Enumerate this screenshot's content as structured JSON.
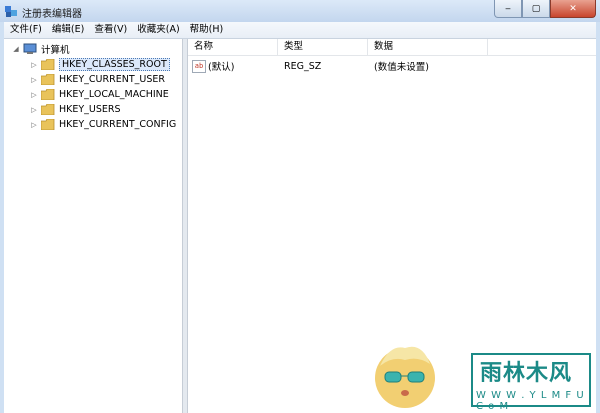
{
  "window": {
    "title": "注册表编辑器",
    "min_glyph": "‒",
    "max_glyph": "▢",
    "close_glyph": "✕"
  },
  "menu": [
    "文件(F)",
    "编辑(E)",
    "查看(V)",
    "收藏夹(A)",
    "帮助(H)"
  ],
  "tree": {
    "root": "计算机",
    "items": [
      {
        "label": "HKEY_CLASSES_ROOT",
        "selected": true
      },
      {
        "label": "HKEY_CURRENT_USER"
      },
      {
        "label": "HKEY_LOCAL_MACHINE"
      },
      {
        "label": "HKEY_USERS"
      },
      {
        "label": "HKEY_CURRENT_CONFIG"
      }
    ],
    "expand_glyph": "▷",
    "root_expand_glyph": "◢"
  },
  "list": {
    "columns": [
      "名称",
      "类型",
      "数据"
    ],
    "rows": [
      {
        "name": "(默认)",
        "type": "REG_SZ",
        "data": "(数值未设置)",
        "icon_text": "ab"
      }
    ]
  },
  "watermark": {
    "title": "雨林木风",
    "subtitle": "W W W . Y L M F U . C o M"
  },
  "colors": {
    "accent": "#1b8a87",
    "title_bar": "#c3d6ee",
    "selection": "#dce9fb"
  }
}
